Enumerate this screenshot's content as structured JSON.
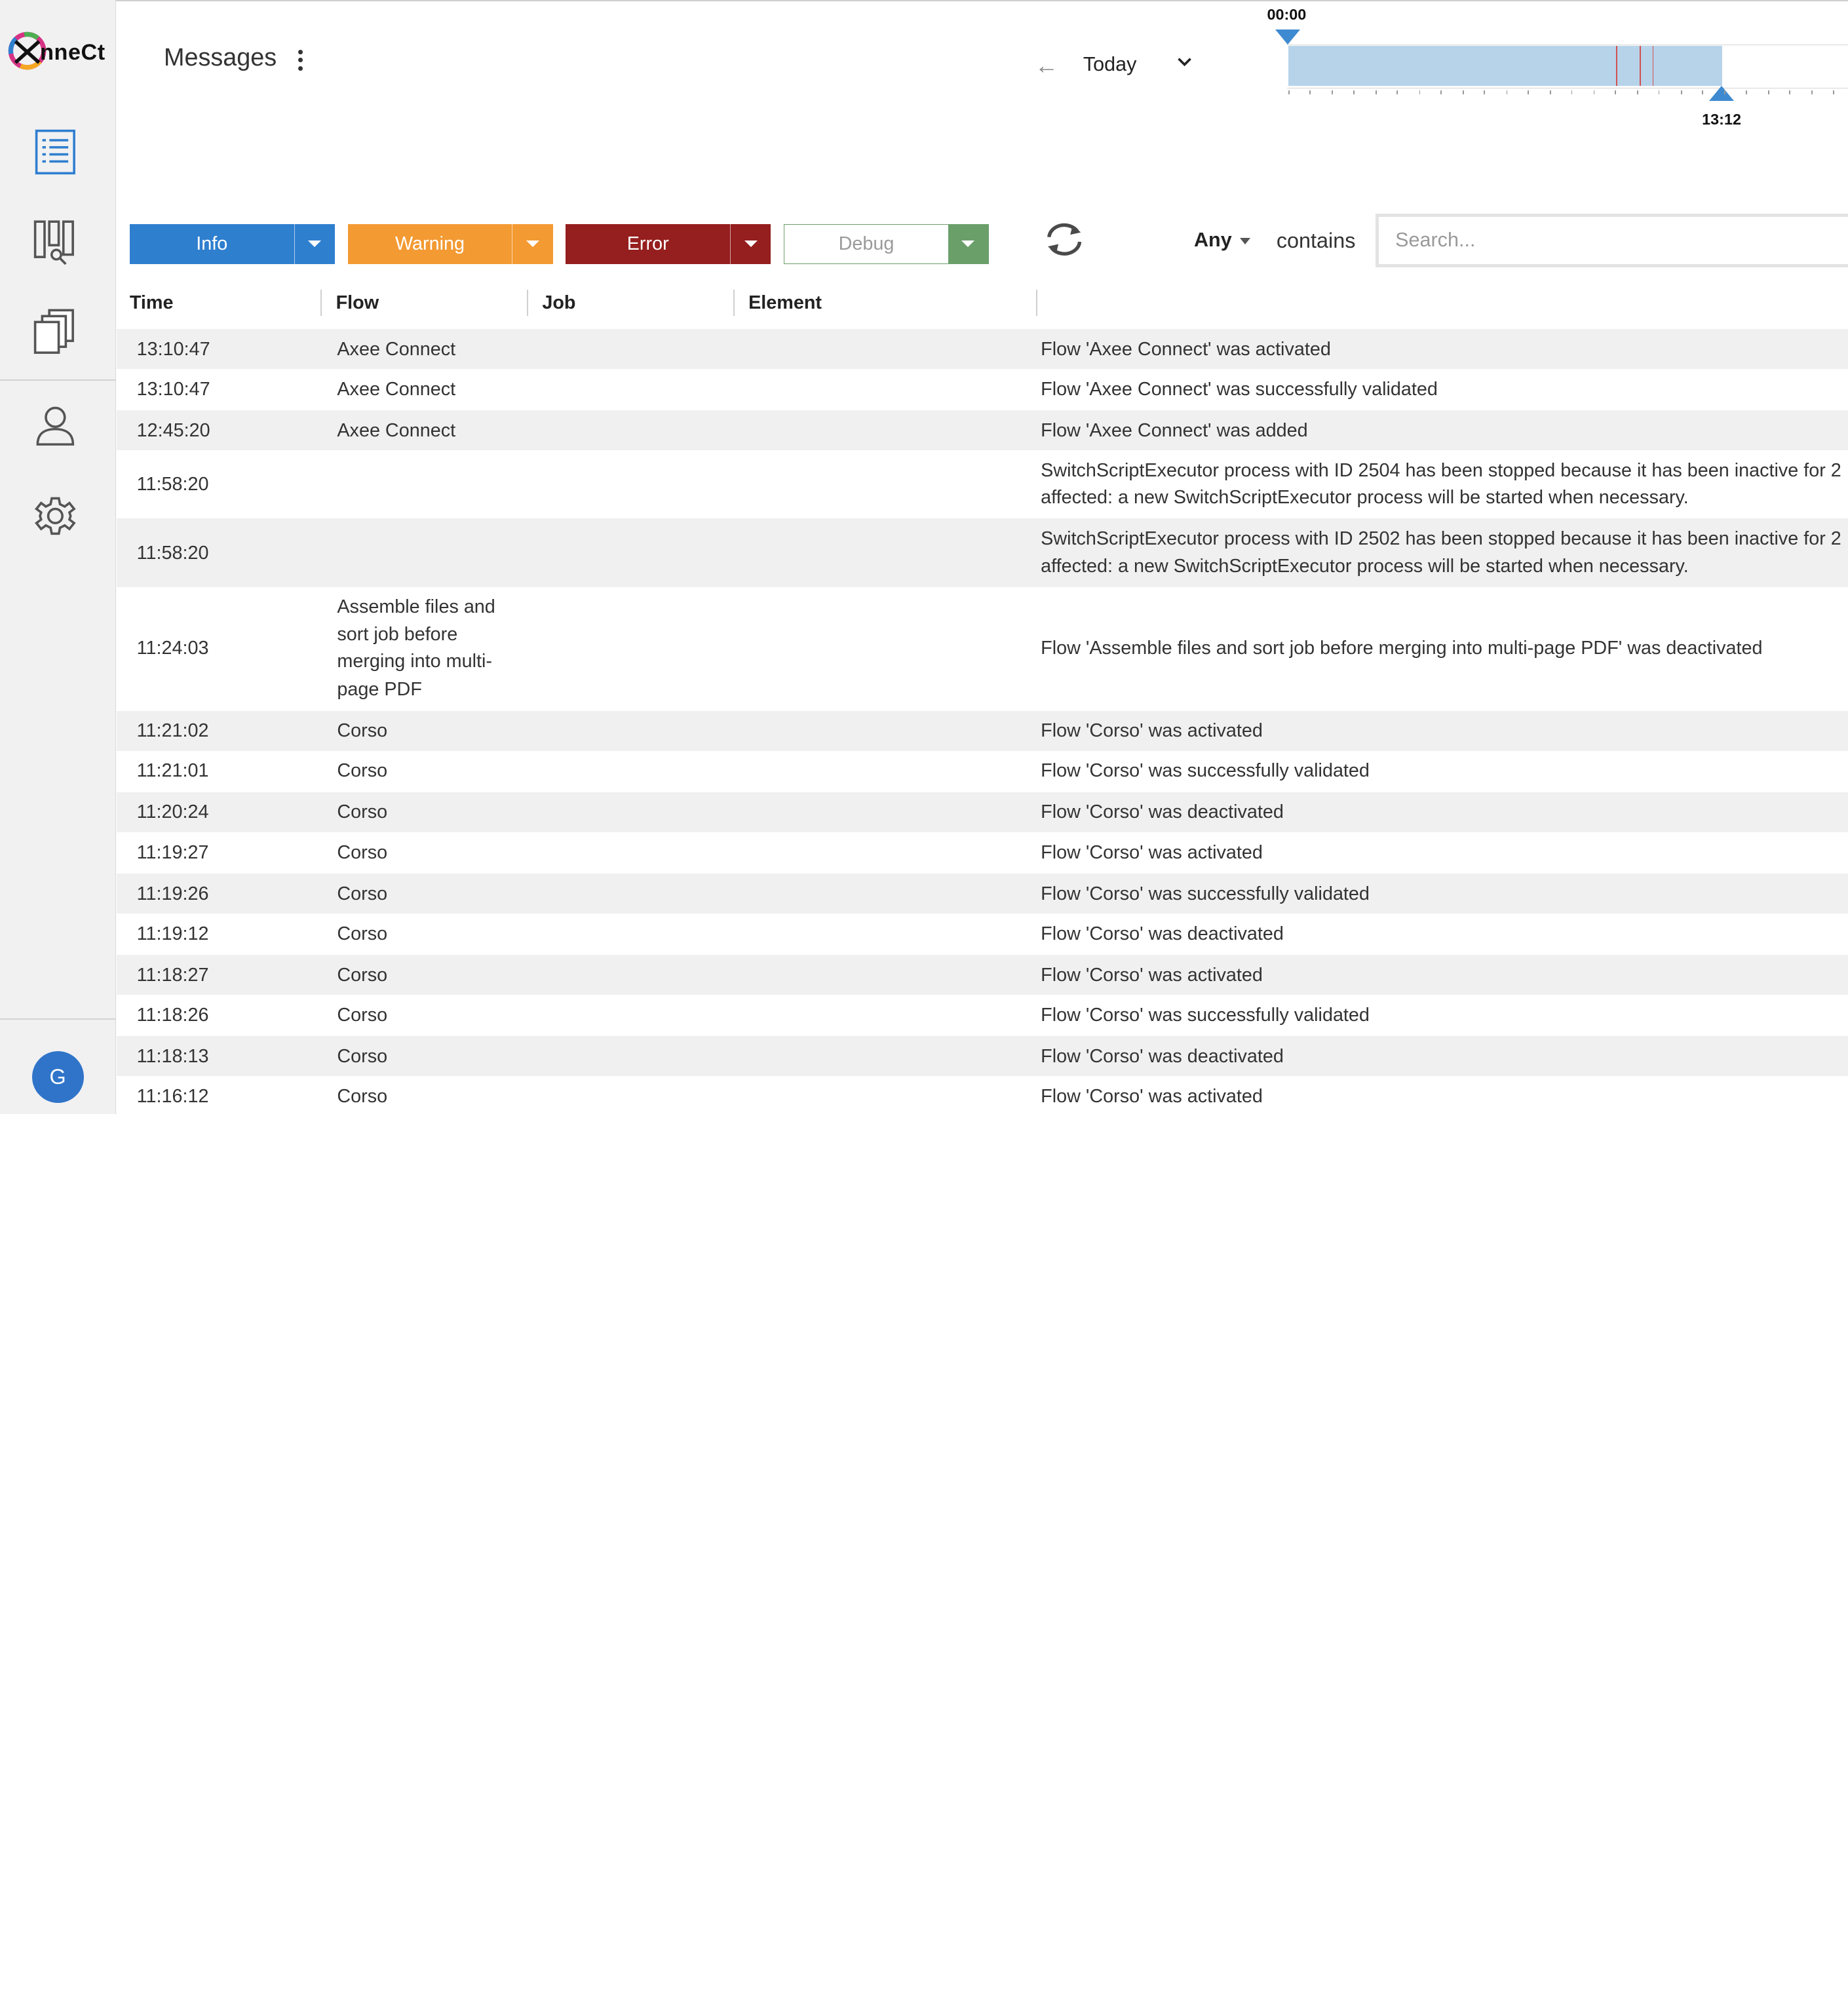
{
  "app": {
    "logo_text": "nneCt"
  },
  "header": {
    "title": "Messages",
    "back_icon": "arrow-left-icon",
    "period": "Today"
  },
  "timeline": {
    "start_label": "00:00",
    "end_label": "13:12"
  },
  "filters": {
    "info": {
      "label": "Info",
      "color": "#2f7fcf"
    },
    "warning": {
      "label": "Warning",
      "color": "#f39a33"
    },
    "error": {
      "label": "Error",
      "color": "#951e1e"
    },
    "debug": {
      "label": "Debug",
      "color": "#6a9f6a"
    }
  },
  "search": {
    "scope": "Any",
    "operator": "contains",
    "placeholder": "Search..."
  },
  "user": {
    "initial": "G"
  },
  "table": {
    "columns": [
      "Time",
      "Flow",
      "Job",
      "Element"
    ],
    "rows": [
      {
        "time": "13:10:47",
        "flow": "Axee Connect",
        "message": "Flow 'Axee Connect' was activated"
      },
      {
        "time": "13:10:47",
        "flow": "Axee Connect",
        "message": "Flow 'Axee Connect' was successfully validated"
      },
      {
        "time": "12:45:20",
        "flow": "Axee Connect",
        "message": "Flow 'Axee Connect' was added"
      },
      {
        "time": "11:58:20",
        "flow": "",
        "message": "SwitchScriptExecutor process with ID 2504 has been stopped because it has been inactive for 2",
        "message_2": "affected: a new SwitchScriptExecutor process will be started when necessary."
      },
      {
        "time": "11:58:20",
        "flow": "",
        "message": "SwitchScriptExecutor process with ID 2502 has been stopped because it has been inactive for 2",
        "message_2": "affected: a new SwitchScriptExecutor process will be started when necessary."
      },
      {
        "time": "11:24:03",
        "flow": "Assemble files and",
        "flow_2": "sort job before",
        "flow_3": "merging into multi-",
        "flow_4": "page PDF",
        "message": "Flow 'Assemble files and sort job before merging into multi-page PDF' was deactivated"
      },
      {
        "time": "11:21:02",
        "flow": "Corso",
        "message": "Flow 'Corso' was activated"
      },
      {
        "time": "11:21:01",
        "flow": "Corso",
        "message": "Flow 'Corso' was successfully validated"
      },
      {
        "time": "11:20:24",
        "flow": "Corso",
        "message": "Flow 'Corso' was deactivated"
      },
      {
        "time": "11:19:27",
        "flow": "Corso",
        "message": "Flow 'Corso' was activated"
      },
      {
        "time": "11:19:26",
        "flow": "Corso",
        "message": "Flow 'Corso' was successfully validated"
      },
      {
        "time": "11:19:12",
        "flow": "Corso",
        "message": "Flow 'Corso' was deactivated"
      },
      {
        "time": "11:18:27",
        "flow": "Corso",
        "message": "Flow 'Corso' was activated"
      },
      {
        "time": "11:18:26",
        "flow": "Corso",
        "message": "Flow 'Corso' was successfully validated"
      },
      {
        "time": "11:18:13",
        "flow": "Corso",
        "message": "Flow 'Corso' was deactivated"
      },
      {
        "time": "11:16:12",
        "flow": "Corso",
        "message": "Flow 'Corso' was activated"
      }
    ]
  }
}
